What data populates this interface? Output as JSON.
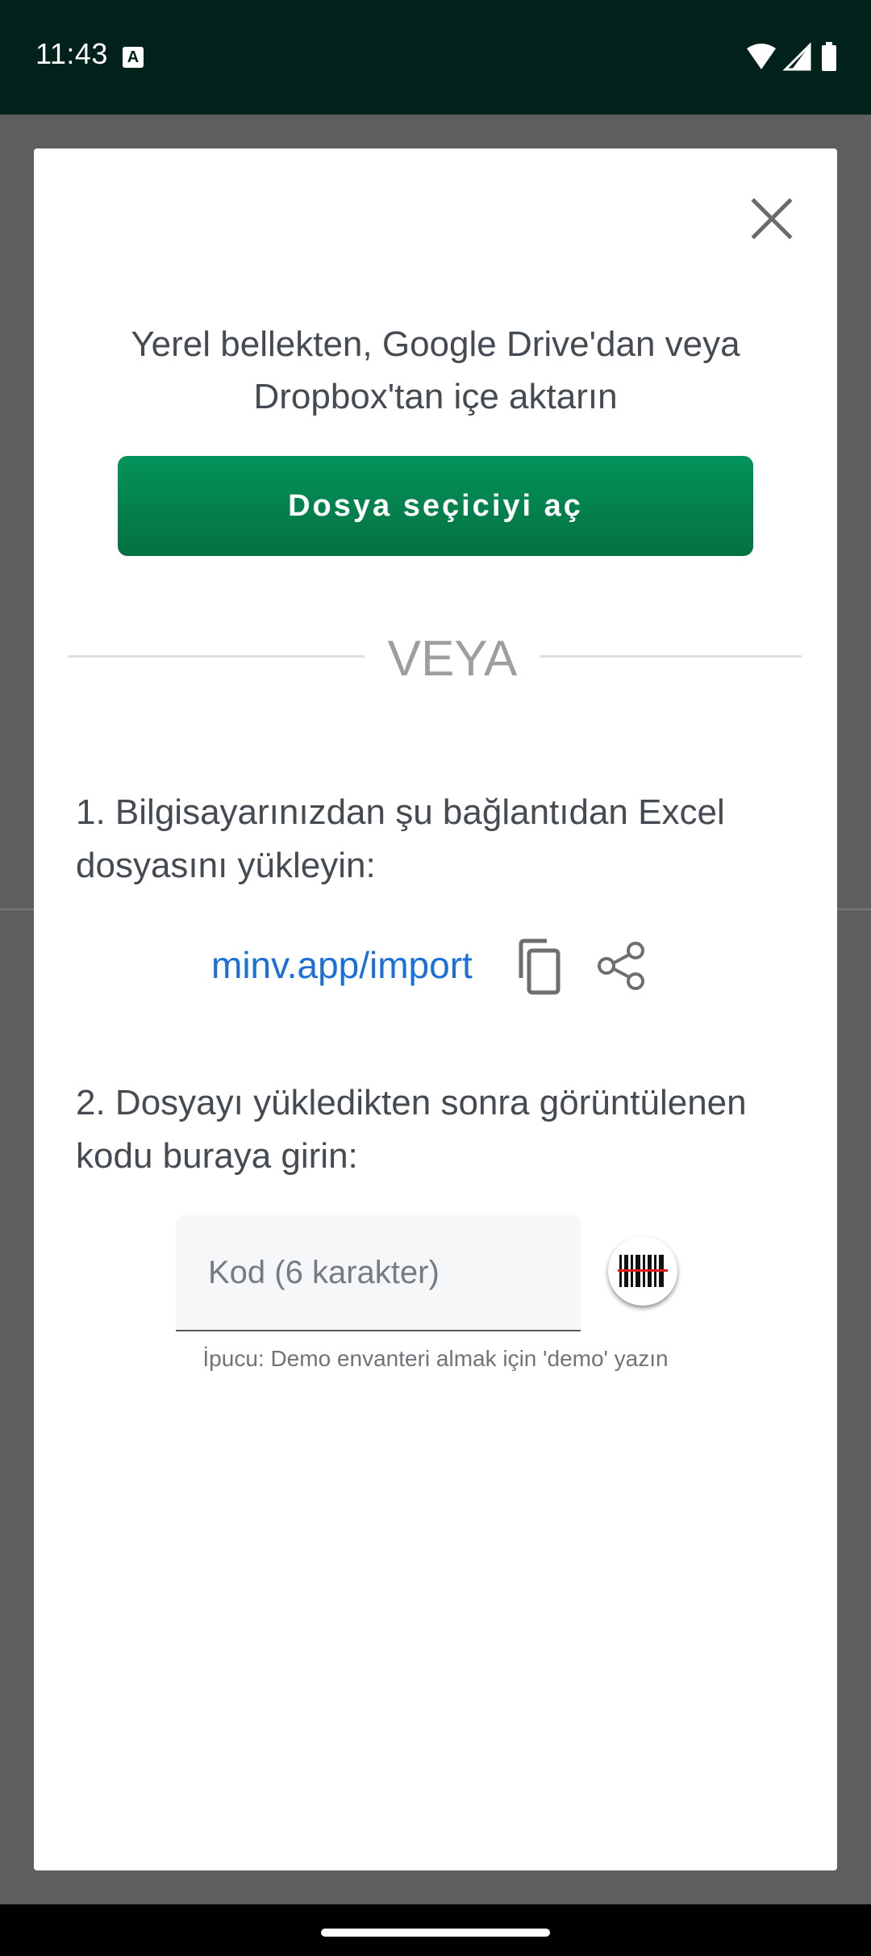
{
  "status_bar": {
    "time": "11:43",
    "notification_icon": "a-icon",
    "icons": [
      "wifi-icon",
      "signal-icon",
      "battery-icon"
    ]
  },
  "dialog": {
    "close_icon": "close-icon",
    "intro_text": "Yerel bellekten, Google Drive'dan veya Dropbox'tan içe aktarın",
    "file_picker_button": "Dosya seçiciyi aç",
    "divider_text": "VEYA",
    "step1_text": "1. Bilgisayarınızdan şu bağlantıdan Excel dosyasını yükleyin:",
    "link_text": "minv.app/import",
    "step2_text": "2. Dosyayı yükledikten sonra görüntülenen kodu buraya girin:",
    "code_input": {
      "value": "",
      "placeholder": "Kod (6 karakter)"
    },
    "hint_text": "İpucu: Demo envanteri almak için 'demo' yazın"
  },
  "colors": {
    "status_bar_bg": "#00221b",
    "button_green": "#04935c",
    "link_blue": "#1a6fd9",
    "scrim": "#5e5e5e"
  }
}
